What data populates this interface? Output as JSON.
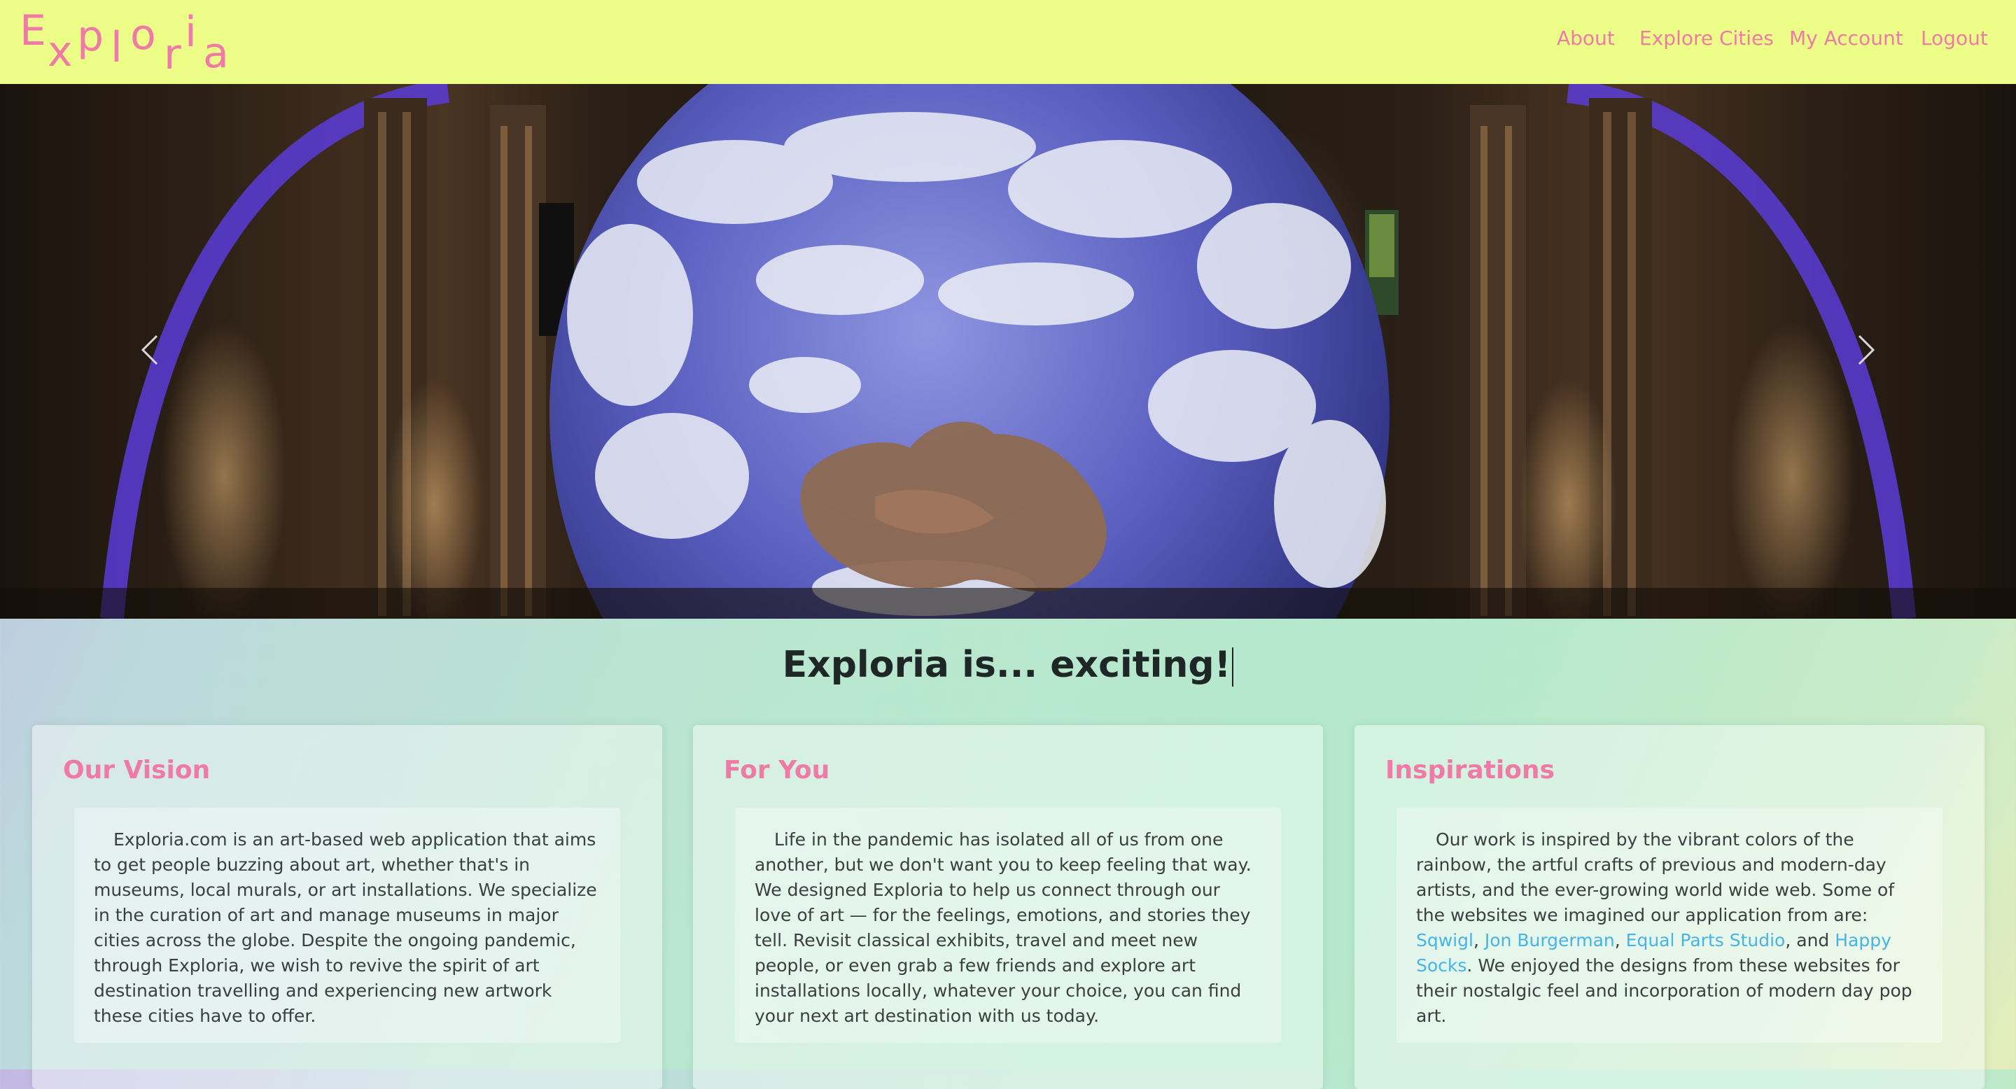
{
  "brand": {
    "letters": [
      "E",
      "x",
      "p",
      "l",
      "o",
      "r",
      "i",
      "a"
    ]
  },
  "nav": {
    "about": "About",
    "explore": "Explore Cities",
    "account": "My Account",
    "logout": "Logout"
  },
  "colors": {
    "navbar": "#ecfe88",
    "accent_pink": "#ef7aa6",
    "link_blue": "#45b4e8"
  },
  "hero": {
    "prev_icon": "chevron-left-icon",
    "next_icon": "chevron-right-icon"
  },
  "headline": "Exploria is... exciting!",
  "cards": [
    {
      "title": "Our Vision",
      "text": "Exploria.com is an art-based web application that aims to get people buzzing about art, whether that's in museums, local murals, or art installations. We specialize in the curation of art and manage museums in major cities across the globe. Despite the ongoing pandemic, through Exploria, we wish to revive the spirit of art destination travelling and experiencing new artwork these cities have to offer."
    },
    {
      "title": "For You",
      "text": "Life in the pandemic has isolated all of us from one another, but we don't want you to keep feeling that way. We designed Exploria to help us connect through our love of art — for the feelings, emotions, and stories they tell. Revisit classical exhibits, travel and meet new people, or even grab a few friends and explore art installations locally, whatever your choice, you can find your next art destination with us today."
    },
    {
      "title": "Inspirations",
      "text_before": "Our work is inspired by the vibrant colors of the rainbow, the artful crafts of previous and modern-day artists, and the ever-growing world wide web. Some of the websites we imagined our application from are:",
      "links": [
        "Sqwigl",
        "Jon Burgerman",
        "Equal Parts Studio",
        "Happy Socks"
      ],
      "sep1": ",",
      "sep2": ",",
      "sep3": ", and",
      "text_after": ". We enjoyed the designs from these websites for their nostalgic feel and incorporation of modern day pop art."
    }
  ]
}
